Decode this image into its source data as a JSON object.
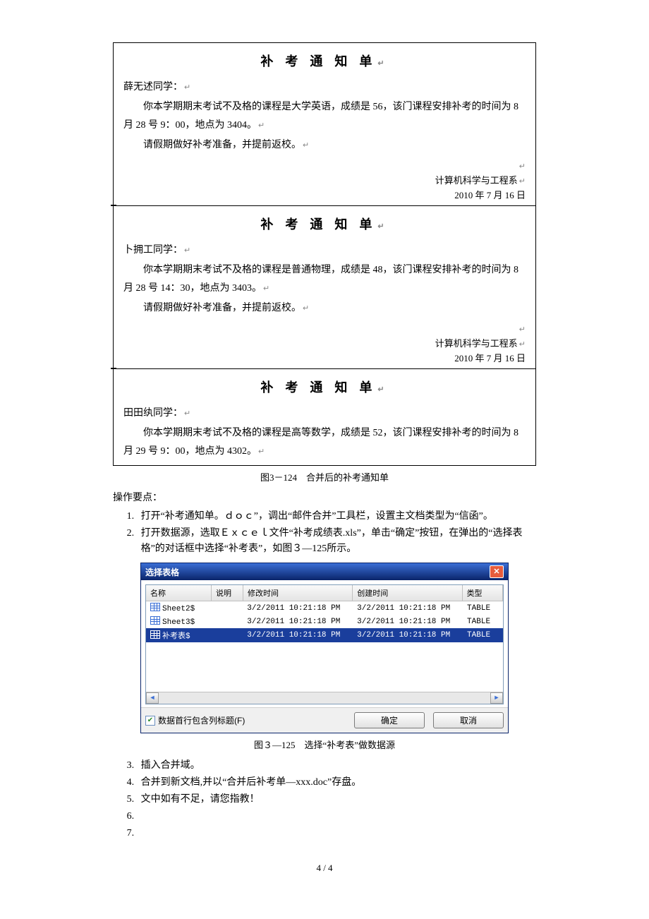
{
  "notices": [
    {
      "title": "补 考 通 知 单",
      "name_line": "薛无述同学：",
      "body1": "你本学期期末考试不及格的课程是大学英语，成绩是 56，该门课程安排补考的时间为 8 月 28 号 9：00，地点为 3404。",
      "body2": "请假期做好补考准备，并提前返校。",
      "sig1": "计算机科学与工程系",
      "sig2": "2010 年 7 月 16 日"
    },
    {
      "title": "补 考 通 知 单",
      "name_line": "卜拥工同学：",
      "body1": "你本学期期末考试不及格的课程是普通物理，成绩是 48，该门课程安排补考的时间为 8 月 28 号 14：30，地点为 3403。",
      "body2": "请假期做好补考准备，并提前返校。",
      "sig1": "计算机科学与工程系",
      "sig2": "2010 年 7 月 16 日"
    },
    {
      "title": "补 考 通 知 单",
      "name_line": "田田纨同学：",
      "body1": "你本学期期末考试不及格的课程是高等数学，成绩是 52，该门课程安排补考的时间为 8 月 29 号 9：00，地点为 4302。",
      "body2": "",
      "sig1": "",
      "sig2": ""
    }
  ],
  "caption1": "图3－124　合并后的补考通知单",
  "ops_heading": "操作要点：",
  "steps": [
    "打开“补考通知单。ｄｏｃ”，调出“邮件合并”工具栏，设置主文档类型为“信函”。",
    "打开数据源，选取Ｅｘｃｅｌ文件“补考成绩表.xls”，单击“确定”按钮，在弹出的“选择表格”的对话框中选择“补考表”，如图３—125所示。"
  ],
  "dialog": {
    "title": "选择表格",
    "columns": {
      "name": "名称",
      "desc": "说明",
      "mod": "修改时间",
      "cre": "创建时间",
      "typ": "类型"
    },
    "rows": [
      {
        "name": "Sheet2$",
        "desc": "",
        "mod": "3/2/2011 10:21:18 PM",
        "cre": "3/2/2011 10:21:18 PM",
        "typ": "TABLE",
        "selected": false
      },
      {
        "name": "Sheet3$",
        "desc": "",
        "mod": "3/2/2011 10:21:18 PM",
        "cre": "3/2/2011 10:21:18 PM",
        "typ": "TABLE",
        "selected": false
      },
      {
        "name": "补考表$",
        "desc": "",
        "mod": "3/2/2011 10:21:18 PM",
        "cre": "3/2/2011 10:21:18 PM",
        "typ": "TABLE",
        "selected": true
      }
    ],
    "check_label": "数据首行包含列标题(F)",
    "ok": "确定",
    "cancel": "取消"
  },
  "caption2": "图３—125　选择“补考表”做数据源",
  "steps2": [
    "插入合并域。",
    "合并到新文档,并以“合并后补考单—xxx.doc”存盘。",
    "文中如有不足，请您指教！",
    "",
    ""
  ],
  "page_num": "4 / 4"
}
